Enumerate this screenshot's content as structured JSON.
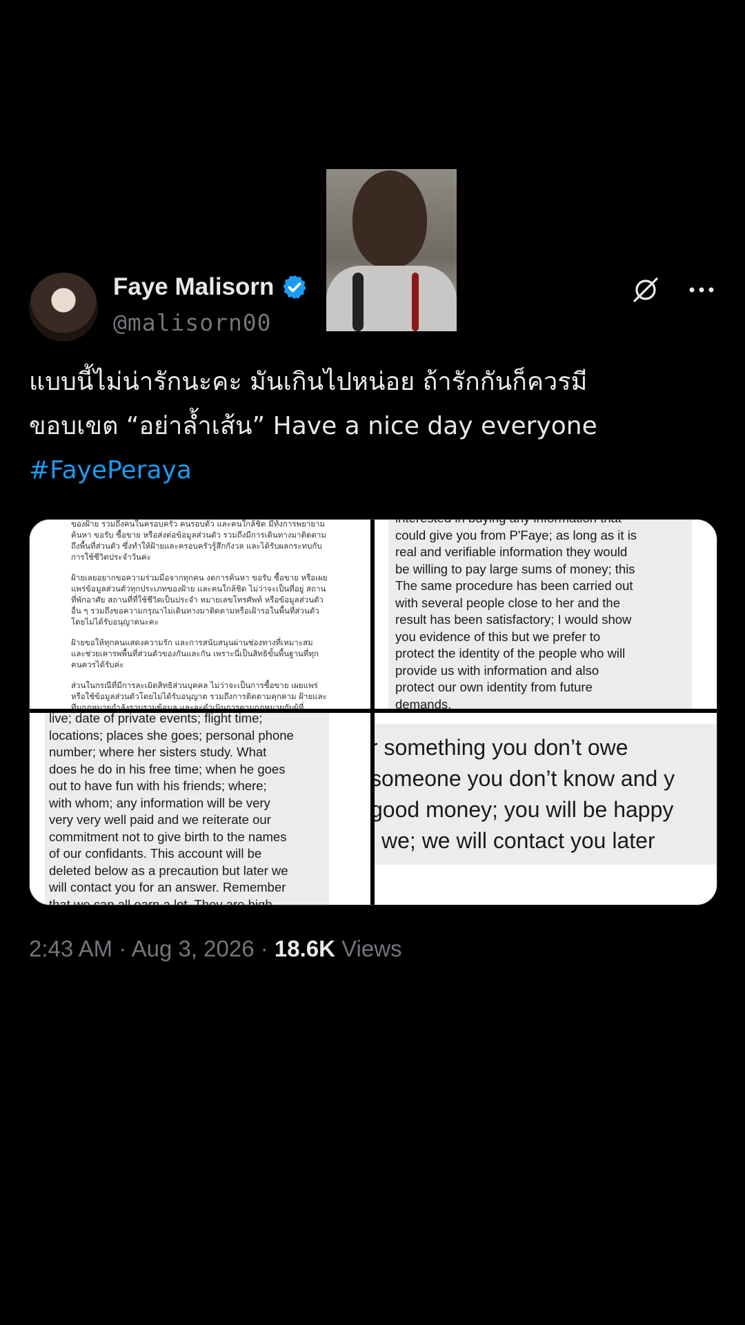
{
  "tweet": {
    "author": {
      "display_name": "Faye Malisorn",
      "handle": "@malisorn00",
      "verified_color": "#1d9bf0"
    },
    "text_lines": [
      "แบบนี้ไม่น่ารักนะคะ มันเกินไปหน่อย ถ้ารักกันก็ควรมี",
      "ขอบเขต “อย่าล้ำเส้น” Have a nice day everyone"
    ],
    "hashtag": "#FayePeraya",
    "timestamp": "2:43 AM · Aug 3, 2026 · ",
    "views_count": "18.6K",
    "views_label": " Views",
    "icons": [
      "grok-icon",
      "more-icon",
      "verified-badge-icon"
    ]
  },
  "media": {
    "thai_paragraphs": [
      "ของฝ้าย รวมถึงคนในครอบครัว คนรอบตัว และคนใกล้ชิด มีทั้งการพยายามค้นหา ขอรับ ซื้อขาย หรือส่งต่อข้อมูลส่วนตัว รวมถึงมีการเดินทางมาติดตามถึงพื้นที่ส่วนตัว ซึ่งทำให้ฝ้ายและครอบครัวรู้สึกกังวล และได้รับผลกระทบกับการใช้ชีวิตประจำวันค่ะ",
      "ฝ้ายเลยอยากขอความร่วมมือจากทุกคน งดการค้นหา ขอรับ ซื้อขาย หรือเผยแพร่ข้อมูลส่วนตัวทุกประเภทของฝ้าย และคนใกล้ชิด ไม่ว่าจะเป็นที่อยู่ สถานที่พักอาศัย สถานที่ที่ใช้ชีวิตเป็นประจำ หมายเลขโทรศัพท์ หรือข้อมูลส่วนตัวอื่น ๆ รวมถึงขอความกรุณาไม่เดินทางมาติดตามหรือเฝ้ารอในพื้นที่ส่วนตัวโดยไม่ได้รับอนุญาตนะคะ",
      "ฝ้ายขอให้ทุกคนแสดงความรัก และการสนับสนุนผ่านช่องทางที่เหมาะสม และช่วยเคารพพื้นที่ส่วนตัวของกันและกัน เพราะนี่เป็นสิทธิขั้นพื้นฐานที่ทุกคนควรได้รับค่ะ",
      "ส่วนในกรณีที่มีการละเมิดสิทธิส่วนบุคคล ไม่ว่าจะเป็นการซื้อขาย เผยแพร่ หรือใช้ข้อมูลส่วนตัวโดยไม่ได้รับอนุญาต รวมถึงการติดตามคุกคาม ฝ้ายและทีมกฎหมายกำลังรวบรวมข้อมูล และจะดำเนินการตามกฎหมายกับผู้ที่เกี่ยวข้อง เพื่อปกป้องสิทธิ ความปลอดภัย และความเป็นส่วนตัวของทุกฝ่ายค่ะ"
    ],
    "top_right_lines": [
      "interested in buying any information that",
      "could give you from P'Faye; as long as it is",
      "real and verifiable information they would",
      "be willing to pay large sums of money; this",
      "The same procedure has been carried out",
      "with several people close to her and the",
      "result has been satisfactory; I would show",
      "you evidence of this but we prefer to",
      "protect the identity of the people who will",
      "provide us with information and also",
      "protect our own identity from future",
      "demands."
    ],
    "bottom_left_lines": [
      "live; date of private events; flight time;",
      "locations; places she goes; personal phone",
      "number; where her sisters study. What",
      "does he do in his free time; when he goes",
      "out to have fun with his friends; where;",
      "with whom; any information will be very",
      "very very well paid and we reiterate our",
      "commitment not to give birth to the names",
      "of our confidants. This account will be",
      "deleted below as a precaution but later we",
      "will contact you for an answer. Remember",
      "that we can all earn a lot. They are high"
    ],
    "bottom_right_lines": [
      "r something you don’t owe",
      "someone you don’t know and y",
      "good money; you will be happy",
      "l we; we will contact you later"
    ]
  }
}
